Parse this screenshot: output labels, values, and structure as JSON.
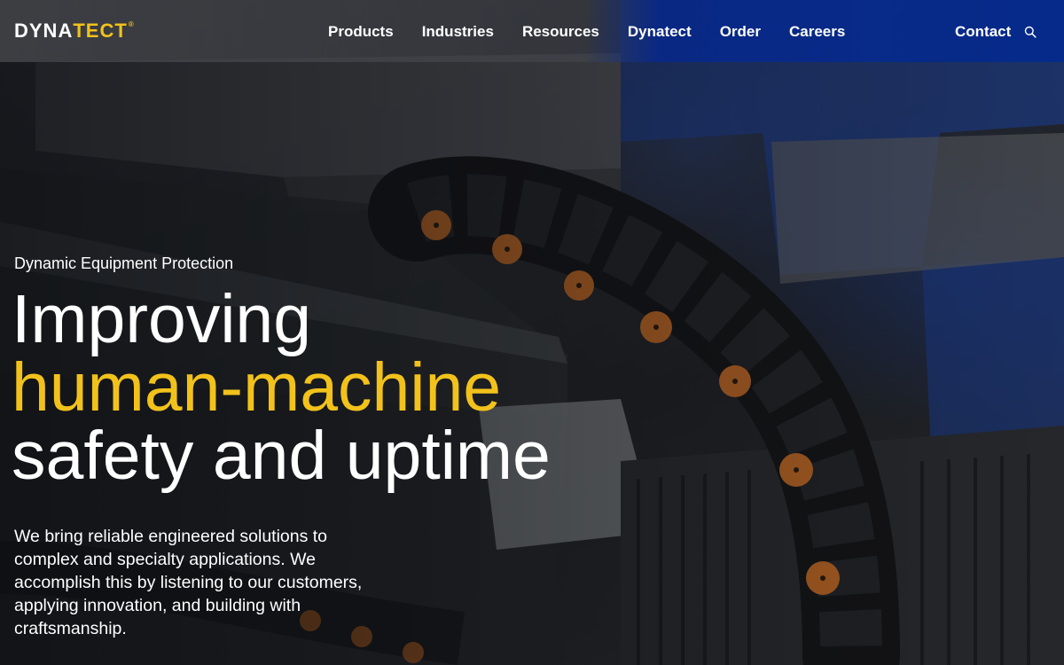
{
  "brand": {
    "logo_part1": "DYNA",
    "logo_part2": "TECT",
    "logo_mark": "®",
    "accent_color": "#f2c21b",
    "nav_blue": "#062a8a"
  },
  "nav": {
    "items": [
      {
        "label": "Products"
      },
      {
        "label": "Industries"
      },
      {
        "label": "Resources"
      },
      {
        "label": "Dynatect"
      },
      {
        "label": "Order"
      },
      {
        "label": "Careers"
      }
    ],
    "contact_label": "Contact",
    "search_icon": "search-icon"
  },
  "hero": {
    "eyebrow": "Dynamic Equipment Protection",
    "headline_line1": "Improving",
    "headline_line2": "human-machine",
    "headline_line3": "safety and uptime",
    "lead": "We bring reliable engineered solutions to complex and specialty applications. We accomplish this by listening to our customers, applying innovation, and building with craftsmanship."
  }
}
